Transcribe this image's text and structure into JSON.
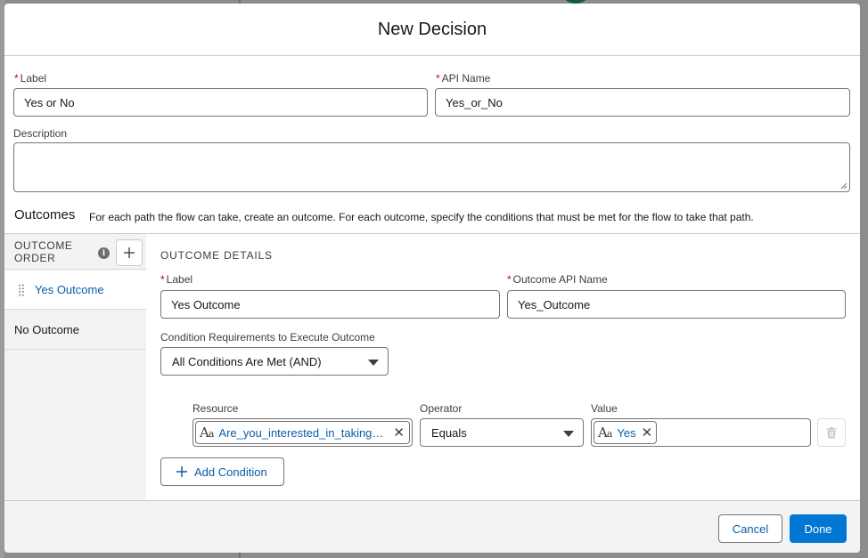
{
  "dialog": {
    "title": "New Decision"
  },
  "fields": {
    "label": {
      "label": "Label",
      "value": "Yes or No"
    },
    "api_name": {
      "label": "API Name",
      "value": "Yes_or_No"
    },
    "description": {
      "label": "Description",
      "value": ""
    }
  },
  "outcomes": {
    "title": "Outcomes",
    "help": "For each path the flow can take, create an outcome. For each outcome, specify the conditions that must be met for the flow to take that path.",
    "order_label": "OUTCOME ORDER",
    "items": [
      {
        "label": "Yes Outcome",
        "active": true
      },
      {
        "label": "No Outcome",
        "active": false
      }
    ]
  },
  "details": {
    "title": "OUTCOME DETAILS",
    "label": {
      "label": "Label",
      "value": "Yes Outcome"
    },
    "api_name": {
      "label": "Outcome API Name",
      "value": "Yes_Outcome"
    },
    "requirements": {
      "label": "Condition Requirements to Execute Outcome",
      "value": "All Conditions Are Met (AND)"
    },
    "condition": {
      "resource_label": "Resource",
      "resource_value": "Are_you_interested_in_taking_a...",
      "operator_label": "Operator",
      "operator_value": "Equals",
      "value_label": "Value",
      "value_value": "Yes"
    },
    "add_condition": "Add Condition"
  },
  "footer": {
    "cancel": "Cancel",
    "done": "Done"
  },
  "colors": {
    "brand": "#0176d3",
    "link": "#0b5cab",
    "required": "#ba0517"
  },
  "icons": [
    "info-icon",
    "add-icon",
    "drag-handle-icon",
    "text-resource-icon",
    "close-icon",
    "chevron-down-icon",
    "trash-icon"
  ]
}
